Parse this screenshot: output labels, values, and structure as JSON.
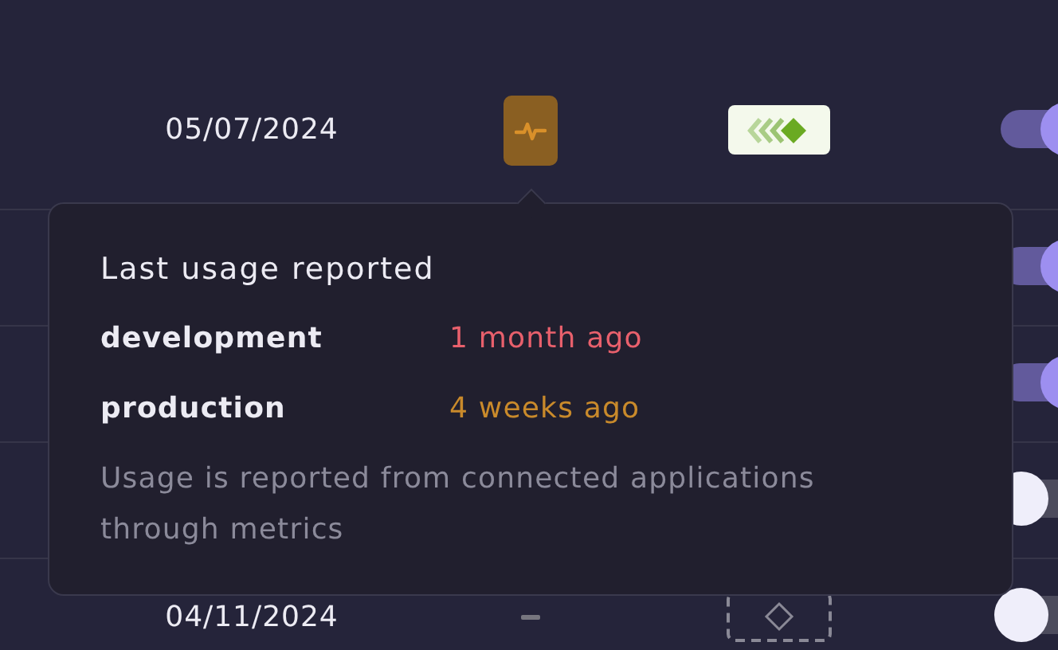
{
  "rows": [
    {
      "date": "05/07/2024",
      "usage": {
        "kind": "activity"
      },
      "integration": {
        "kind": "logo"
      },
      "enabled": true
    },
    {
      "enabled": true
    },
    {
      "enabled": true
    },
    {
      "enabled": false
    },
    {
      "date": "04/11/2024",
      "usage": {
        "kind": "none"
      },
      "integration": {
        "kind": "empty"
      },
      "enabled": false
    }
  ],
  "tooltip": {
    "title": "Last usage reported",
    "entries": [
      {
        "label": "development",
        "value": "1 month ago",
        "color": "#e8606c"
      },
      {
        "label": "production",
        "value": "4 weeks ago",
        "color": "#c98a2b"
      }
    ],
    "note": "Usage is reported from connected applications through metrics"
  }
}
